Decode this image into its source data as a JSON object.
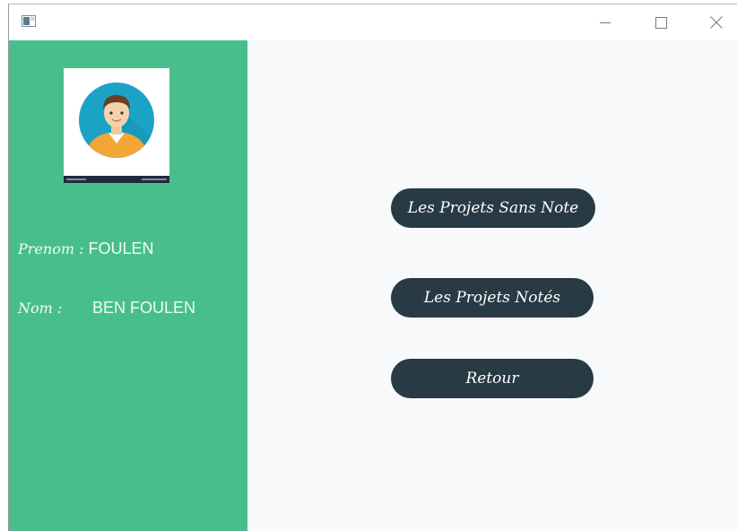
{
  "window": {
    "controls": {
      "minimize_icon": "minimize-icon",
      "maximize_icon": "maximize-icon",
      "close_icon": "close-icon"
    }
  },
  "profile": {
    "avatar_icon": "user-avatar-icon",
    "prenom_label": "Prenom :",
    "prenom_value": "FOULEN",
    "nom_label": "Nom :",
    "nom_value": "BEN FOULEN"
  },
  "actions": {
    "projets_sans_note": "Les Projets Sans Note",
    "projets_notes": "Les Projets Notés",
    "retour": "Retour"
  },
  "colors": {
    "sidebar": "#48bf8b",
    "button": "#283a44",
    "main_bg": "#f8f9fa"
  }
}
